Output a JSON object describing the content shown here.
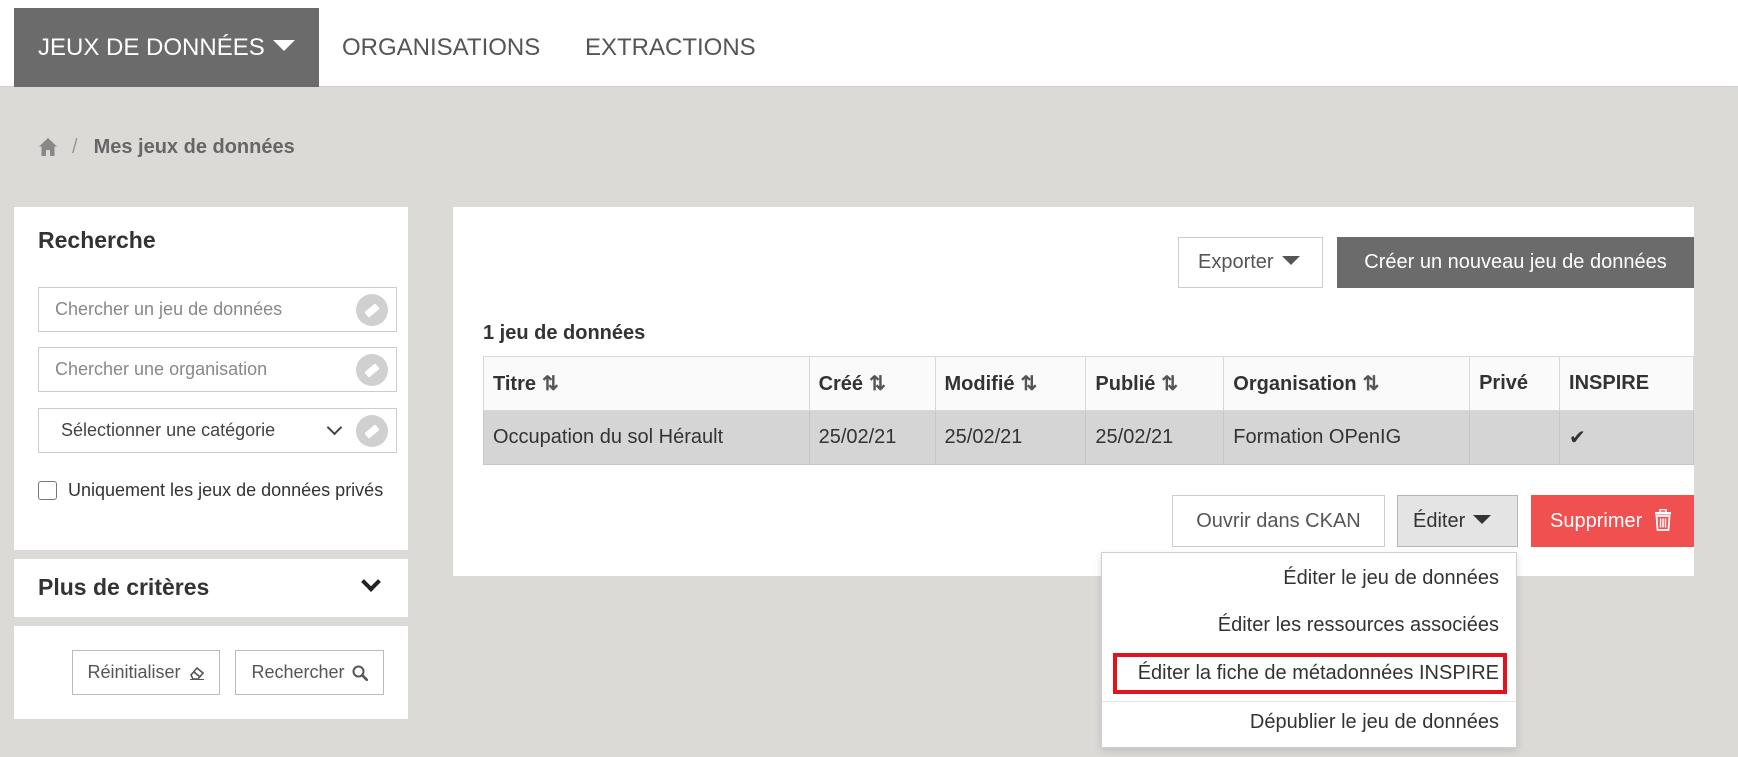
{
  "nav": {
    "datasets": "JEUX DE DONNÉES",
    "organisations": "ORGANISATIONS",
    "extractions": "EXTRACTIONS"
  },
  "breadcrumb": {
    "separator": "/",
    "current": "Mes jeux de données"
  },
  "search": {
    "title": "Recherche",
    "dataset_placeholder": "Chercher un jeu de données",
    "organisation_placeholder": "Chercher une organisation",
    "category_select": "Sélectionner une catégorie",
    "private_only_label": "Uniquement les jeux de données privés",
    "more_criteria": "Plus de critères",
    "reset_label": "Réinitialiser",
    "search_label": "Rechercher"
  },
  "toolbar": {
    "export_label": "Exporter",
    "create_label": "Créer un nouveau jeu de données"
  },
  "results": {
    "count_label": "1 jeu de données",
    "columns": [
      "Titre",
      "Créé",
      "Modifié",
      "Publié",
      "Organisation",
      "Privé",
      "INSPIRE"
    ],
    "sortable": [
      true,
      true,
      true,
      true,
      true,
      false,
      false
    ],
    "rows": [
      {
        "title": "Occupation du sol Hérault",
        "created": "25/02/21",
        "modified": "25/02/21",
        "published": "25/02/21",
        "organisation": "Formation OPenIG",
        "private": "",
        "inspire_check": "✔"
      }
    ]
  },
  "actions": {
    "open_ckan": "Ouvrir dans CKAN",
    "edit": "Éditer",
    "delete": "Supprimer"
  },
  "edit_menu": {
    "items": [
      "Éditer le jeu de données",
      "Éditer les ressources associées",
      "Éditer la fiche de métadonnées INSPIRE",
      "Dépublier le jeu de données"
    ],
    "highlighted_index": 2
  },
  "colors": {
    "nav_active_bg": "#6b6b6b",
    "page_bg": "#dcdad7",
    "delete_bg": "#f05050",
    "highlight_border": "#e0141e"
  }
}
